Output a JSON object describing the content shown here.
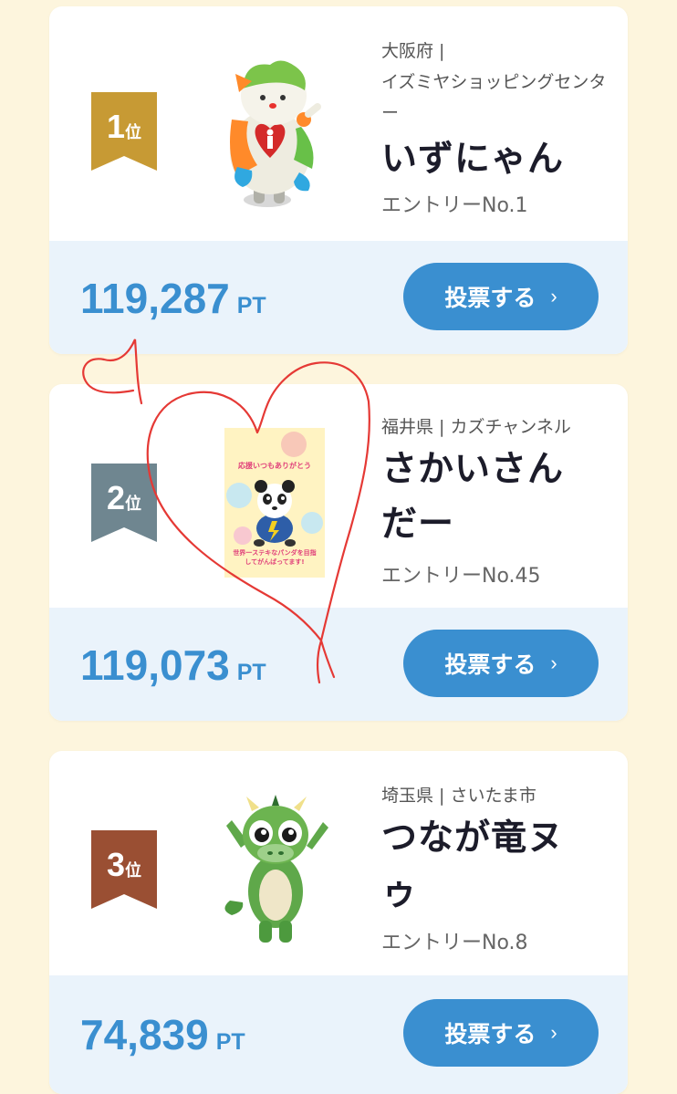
{
  "entries": [
    {
      "rank_num": "1",
      "rank_unit": "位",
      "rank_color": "#c79a34",
      "location": "大阪府 |\nイズミヤショッピングセンター",
      "name": "いずにゃん",
      "entry": "エントリーNo.1",
      "points": "119,287",
      "points_unit": "PT",
      "vote_label": "投票する",
      "mascot_icon": "cat-mascot-icon"
    },
    {
      "rank_num": "2",
      "rank_unit": "位",
      "rank_color": "#6f8690",
      "location": "福井県 | カズチャンネル",
      "name": "さかいさんだー",
      "entry": "エントリーNo.45",
      "points": "119,073",
      "points_unit": "PT",
      "vote_label": "投票する",
      "mascot_icon": "panda-poster-icon",
      "poster_text_top": "応援いつもありがとう",
      "poster_text_bottom": "世界一ステキなパンダを目指してがんばってます!"
    },
    {
      "rank_num": "3",
      "rank_unit": "位",
      "rank_color": "#9a4f33",
      "location": "埼玉県 | さいたま市",
      "name": "つなが竜ヌゥ",
      "entry": "エントリーNo.8",
      "points": "74,839",
      "points_unit": "PT",
      "vote_label": "投票する",
      "mascot_icon": "dragon-mascot-icon"
    }
  ],
  "colors": {
    "background": "#fdf5dd",
    "accent": "#3a8fd0",
    "panel": "#eaf3fb",
    "annotation": "#e53935"
  },
  "chevron": "›"
}
